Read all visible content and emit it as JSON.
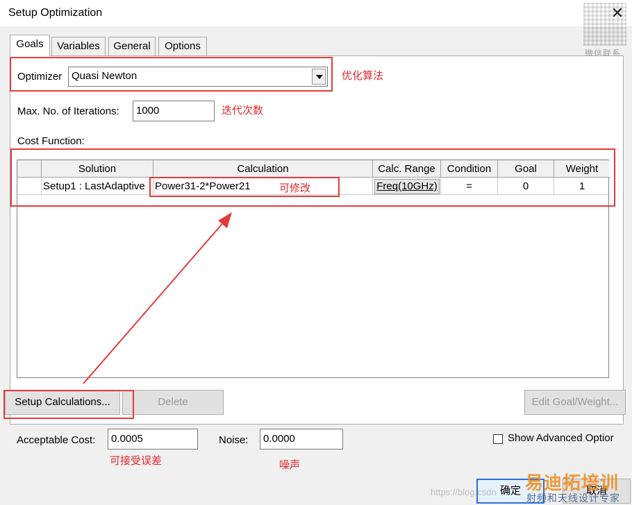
{
  "window": {
    "title": "Setup Optimization",
    "close_glyph": "✕",
    "qr_caption": "微信联系"
  },
  "tabs": [
    {
      "label": "Goals",
      "active": true
    },
    {
      "label": "Variables",
      "active": false
    },
    {
      "label": "General",
      "active": false
    },
    {
      "label": "Options",
      "active": false
    }
  ],
  "optimizer": {
    "label": "Optimizer",
    "value": "Quasi Newton"
  },
  "iterations": {
    "label": "Max. No. of Iterations:",
    "value": "1000"
  },
  "cost_function": {
    "label": "Cost Function:",
    "columns": [
      "",
      "Solution",
      "Calculation",
      "Calc. Range",
      "Condition",
      "Goal",
      "Weight"
    ],
    "rows": [
      {
        "solution": "Setup1 : LastAdaptive",
        "calculation": "Power31-2*Power21",
        "calc_range": "Freq(10GHz)",
        "condition": "=",
        "goal": "0",
        "weight": "1"
      }
    ]
  },
  "buttons": {
    "setup_calculations": "Setup Calculations...",
    "delete": "Delete",
    "edit_goal_weight": "Edit Goal/Weight..."
  },
  "acceptable_cost": {
    "label": "Acceptable Cost:",
    "value": "0.0005"
  },
  "noise": {
    "label": "Noise:",
    "value": "0.0000"
  },
  "show_advanced": {
    "label": "Show Advanced Optior",
    "checked": false
  },
  "footer": {
    "ok": "确定",
    "cancel": "取消"
  },
  "annotations": {
    "optimizer_note": "优化算法",
    "iterations_note": "迭代次数",
    "calculation_note": "可修改",
    "acceptable_note": "可接受误差",
    "noise_note": "噪声",
    "color": "#e53a3a"
  },
  "watermark": {
    "brand": "易迪拓培训",
    "tagline": "射频和天线设计专家",
    "url": "https://blog.csdn"
  },
  "colors": {
    "window_bg": "#f0f0f0",
    "panel_bg": "#ffffff",
    "accent_default_button": "#2f6fd6"
  }
}
